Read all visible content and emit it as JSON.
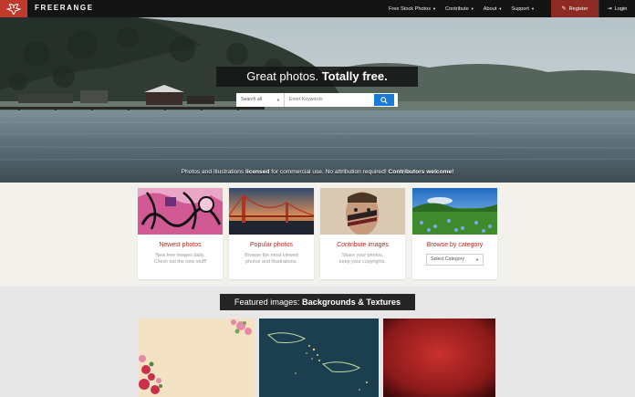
{
  "brand": {
    "name": "FREERANGE",
    "logo_icon": "bird-icon",
    "accent": "#c0392b"
  },
  "nav": {
    "items": [
      {
        "label": "Free Stock Photos"
      },
      {
        "label": "Contribute"
      },
      {
        "label": "About"
      },
      {
        "label": "Support"
      }
    ],
    "register_label": "Register",
    "login_label": "Login"
  },
  "hero": {
    "headline_regular": "Great photos. ",
    "headline_bold": "Totally free.",
    "search": {
      "scope_value": "Search all",
      "placeholder": "Enter Keywords",
      "button_icon": "search-icon",
      "button_color": "#1a7ad9"
    },
    "tagline": {
      "part1": "Photos and Illustrations ",
      "bold1": "licensed",
      "part2": " for commercial use. No attribution required! ",
      "bold2": "Contributors welcome!"
    }
  },
  "categories": [
    {
      "title": "Newest photos",
      "desc1": "New free images daily.",
      "desc2": "Check out the new stuff!"
    },
    {
      "title": "Popular photos",
      "desc1": "Browse the most viewed",
      "desc2": "photos and illustrations."
    },
    {
      "title": "Contribute images",
      "desc1": "Share your photos,",
      "desc2": "keep your copyrights."
    },
    {
      "title": "Browse by category",
      "select_value": "Select Category"
    }
  ],
  "featured": {
    "prefix": "Featured images: ",
    "bold": "Backgrounds & Textures"
  }
}
